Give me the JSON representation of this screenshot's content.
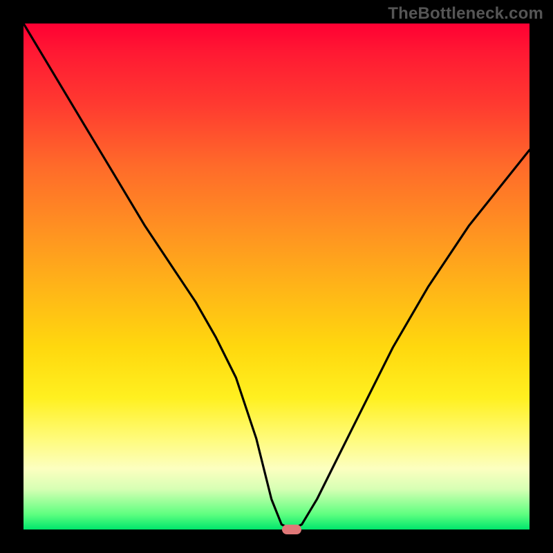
{
  "watermark": "TheBottleneck.com",
  "chart_data": {
    "type": "line",
    "title": "",
    "xlabel": "",
    "ylabel": "",
    "xlim": [
      0,
      100
    ],
    "ylim": [
      0,
      100
    ],
    "background_gradient": {
      "top_color": "#ff0033",
      "bottom_color": "#00e66c",
      "meaning": "red high → green low bottleneck severity"
    },
    "marker": {
      "x": 53,
      "y": 0,
      "color": "#e07878"
    },
    "series": [
      {
        "name": "bottleneck-curve",
        "x": [
          0,
          6,
          12,
          18,
          24,
          30,
          34,
          38,
          42,
          46,
          49,
          51,
          53,
          55,
          58,
          62,
          67,
          73,
          80,
          88,
          96,
          100
        ],
        "values": [
          100,
          90,
          80,
          70,
          60,
          51,
          45,
          38,
          30,
          18,
          6,
          1,
          0,
          1,
          6,
          14,
          24,
          36,
          48,
          60,
          70,
          75
        ]
      }
    ]
  }
}
